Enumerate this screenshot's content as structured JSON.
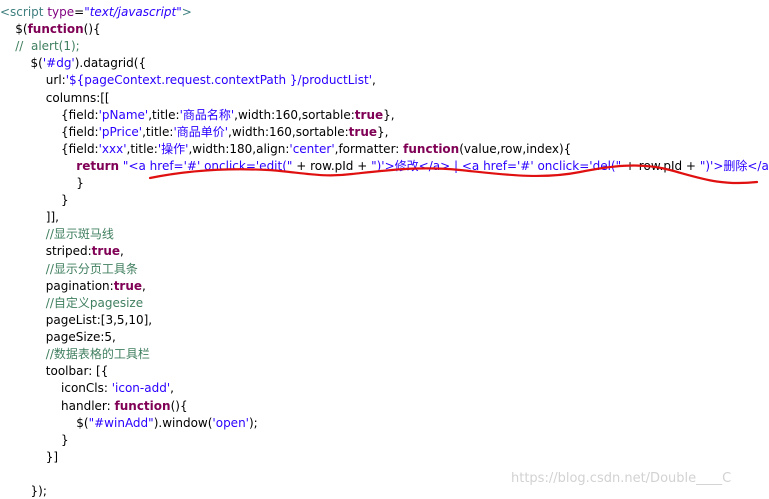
{
  "code_lines": [
    {
      "segments": [
        {
          "t": "<script ",
          "c": "tag"
        },
        {
          "t": "type",
          "c": "attr"
        },
        {
          "t": "=",
          "c": "txt"
        },
        {
          "t": "\"text/javascript\"",
          "c": "val"
        },
        {
          "t": ">",
          "c": "tag"
        }
      ]
    },
    {
      "segments": [
        {
          "t": "    $(",
          "c": "txt"
        },
        {
          "t": "function",
          "c": "kw"
        },
        {
          "t": "(){",
          "c": "txt"
        }
      ]
    },
    {
      "segments": [
        {
          "t": "    //  alert(1);",
          "c": "cm"
        }
      ]
    },
    {
      "segments": [
        {
          "t": "        $(",
          "c": "txt"
        },
        {
          "t": "'#dg'",
          "c": "str"
        },
        {
          "t": ").datagrid({",
          "c": "txt"
        }
      ]
    },
    {
      "segments": [
        {
          "t": "            url:",
          "c": "txt"
        },
        {
          "t": "'${pageContext.request.contextPath }/productList'",
          "c": "str"
        },
        {
          "t": ",",
          "c": "txt"
        }
      ]
    },
    {
      "segments": [
        {
          "t": "            columns:[[",
          "c": "txt"
        }
      ]
    },
    {
      "segments": [
        {
          "t": "                {field:",
          "c": "txt"
        },
        {
          "t": "'pName'",
          "c": "str"
        },
        {
          "t": ",title:",
          "c": "txt"
        },
        {
          "t": "'商品名称'",
          "c": "str"
        },
        {
          "t": ",width:160,sortable:",
          "c": "txt"
        },
        {
          "t": "true",
          "c": "kw"
        },
        {
          "t": "},",
          "c": "txt"
        }
      ]
    },
    {
      "segments": [
        {
          "t": "                {field:",
          "c": "txt"
        },
        {
          "t": "'pPrice'",
          "c": "str"
        },
        {
          "t": ",title:",
          "c": "txt"
        },
        {
          "t": "'商品单价'",
          "c": "str"
        },
        {
          "t": ",width:160,sortable:",
          "c": "txt"
        },
        {
          "t": "true",
          "c": "kw"
        },
        {
          "t": "},",
          "c": "txt"
        }
      ]
    },
    {
      "segments": [
        {
          "t": "                {field:",
          "c": "txt"
        },
        {
          "t": "'xxx'",
          "c": "str"
        },
        {
          "t": ",title:",
          "c": "txt"
        },
        {
          "t": "'操作'",
          "c": "str"
        },
        {
          "t": ",width:180,align:",
          "c": "txt"
        },
        {
          "t": "'center'",
          "c": "str"
        },
        {
          "t": ",formatter: ",
          "c": "txt"
        },
        {
          "t": "function",
          "c": "kw"
        },
        {
          "t": "(value,row,index){",
          "c": "txt"
        }
      ]
    },
    {
      "segments": [
        {
          "t": "                    ",
          "c": "txt"
        },
        {
          "t": "return",
          "c": "kw"
        },
        {
          "t": " ",
          "c": "txt"
        },
        {
          "t": "\"<a href='#' onclick='edit(\"",
          "c": "str"
        },
        {
          "t": " + row.pId + ",
          "c": "txt"
        },
        {
          "t": "\")'>修改</a> | <a href='#' onclick='del(\"",
          "c": "str"
        },
        {
          "t": " + row.pId + ",
          "c": "txt"
        },
        {
          "t": "\")'>删除</a>\"",
          "c": "str"
        },
        {
          "t": ";",
          "c": "txt"
        }
      ]
    },
    {
      "segments": [
        {
          "t": "                    }",
          "c": "txt"
        }
      ]
    },
    {
      "segments": [
        {
          "t": "                }",
          "c": "txt"
        }
      ]
    },
    {
      "segments": [
        {
          "t": "            ]],",
          "c": "txt"
        }
      ]
    },
    {
      "segments": [
        {
          "t": "            //显示斑马线",
          "c": "cm"
        }
      ]
    },
    {
      "segments": [
        {
          "t": "            striped:",
          "c": "txt"
        },
        {
          "t": "true",
          "c": "kw"
        },
        {
          "t": ",",
          "c": "txt"
        }
      ]
    },
    {
      "segments": [
        {
          "t": "            //显示分页工具条",
          "c": "cm"
        }
      ]
    },
    {
      "segments": [
        {
          "t": "            pagination:",
          "c": "txt"
        },
        {
          "t": "true",
          "c": "kw"
        },
        {
          "t": ",",
          "c": "txt"
        }
      ]
    },
    {
      "segments": [
        {
          "t": "            //自定义pagesize",
          "c": "cm"
        }
      ]
    },
    {
      "segments": [
        {
          "t": "            pageList:[3,5,10],",
          "c": "txt"
        }
      ]
    },
    {
      "segments": [
        {
          "t": "            pageSize:5,",
          "c": "txt"
        }
      ]
    },
    {
      "segments": [
        {
          "t": "            //数据表格的工具栏",
          "c": "cm"
        }
      ]
    },
    {
      "segments": [
        {
          "t": "            toolbar: [{",
          "c": "txt"
        }
      ]
    },
    {
      "segments": [
        {
          "t": "                iconCls: ",
          "c": "txt"
        },
        {
          "t": "'icon-add'",
          "c": "str"
        },
        {
          "t": ",",
          "c": "txt"
        }
      ]
    },
    {
      "segments": [
        {
          "t": "                handler: ",
          "c": "txt"
        },
        {
          "t": "function",
          "c": "kw"
        },
        {
          "t": "(){",
          "c": "txt"
        }
      ]
    },
    {
      "segments": [
        {
          "t": "                    $(",
          "c": "txt"
        },
        {
          "t": "\"#winAdd\"",
          "c": "str"
        },
        {
          "t": ").window(",
          "c": "txt"
        },
        {
          "t": "'open'",
          "c": "str"
        },
        {
          "t": ");",
          "c": "txt"
        }
      ]
    },
    {
      "segments": [
        {
          "t": "                }",
          "c": "txt"
        }
      ]
    },
    {
      "segments": [
        {
          "t": "            }]",
          "c": "txt"
        }
      ]
    },
    {
      "segments": [
        {
          "t": "",
          "c": "txt"
        }
      ]
    },
    {
      "segments": [
        {
          "t": "        });",
          "c": "txt"
        }
      ]
    }
  ],
  "watermark": "https://blog.csdn.net/Double____C",
  "colors": {
    "tag": "#3f7f7f",
    "attribute": "#7f007f",
    "keyword": "#7f0055",
    "string": "#2a00ff",
    "comment": "#3f7f5f",
    "annotation_stroke": "#e01010"
  }
}
